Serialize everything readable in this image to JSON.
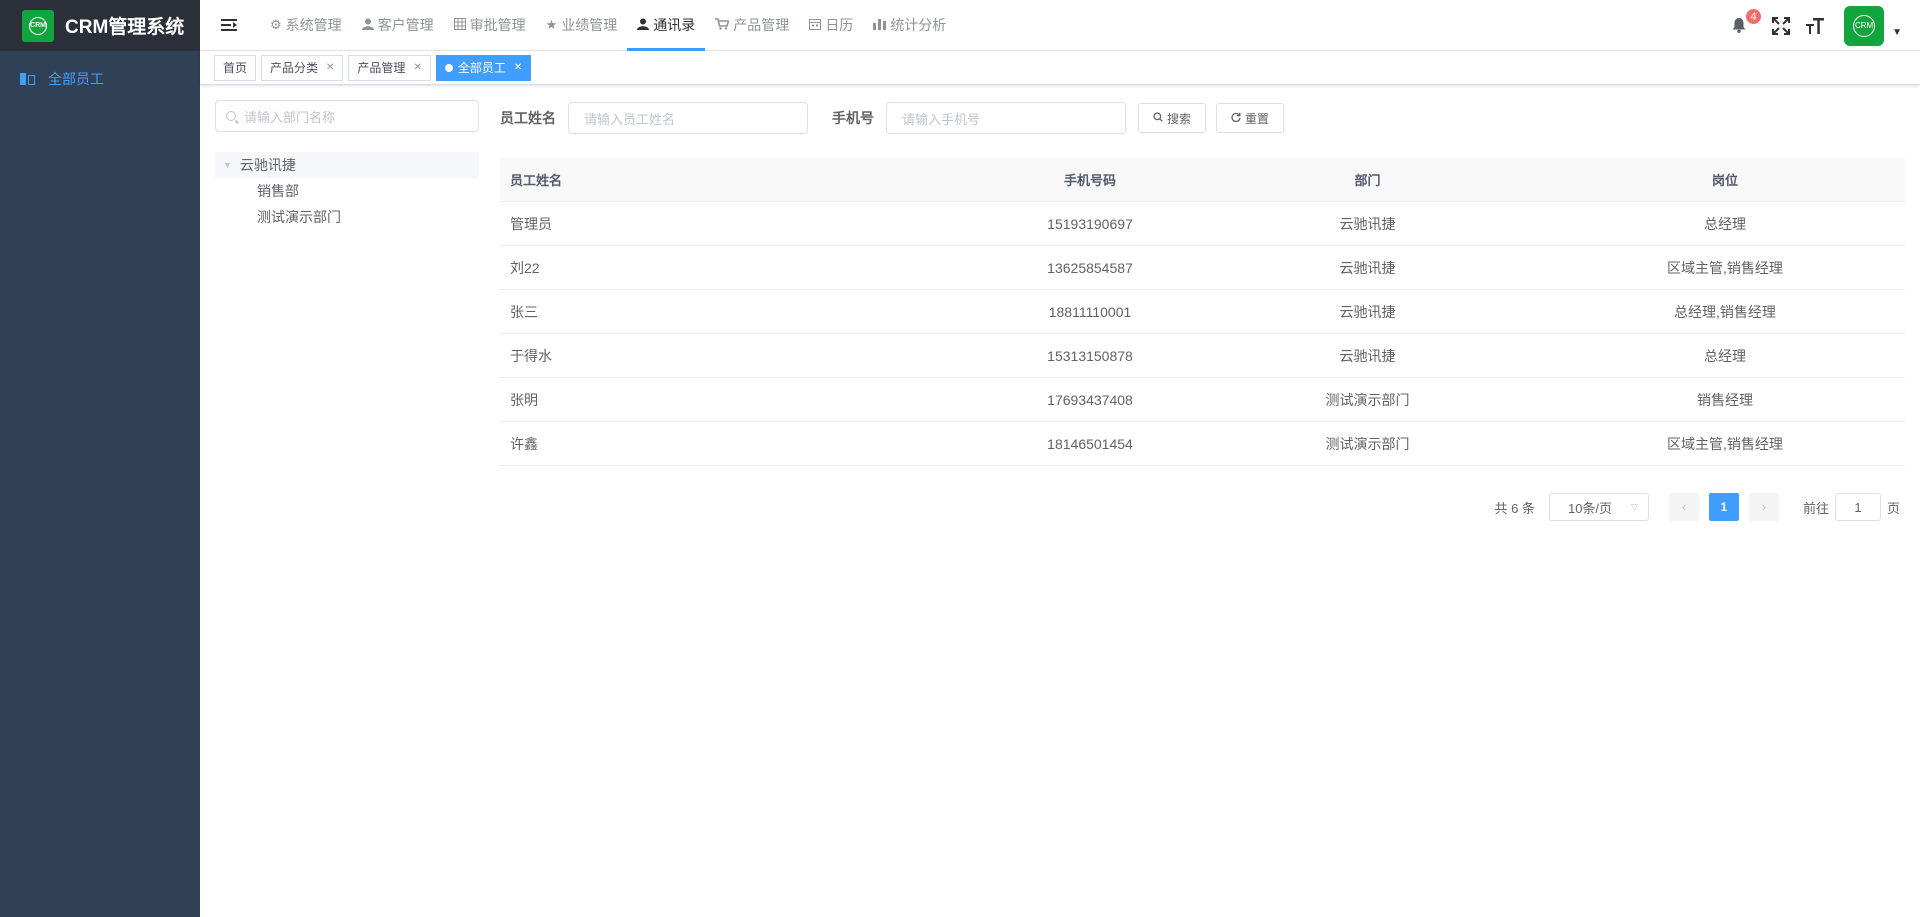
{
  "app": {
    "logo_text": "CRM",
    "title": "CRM管理系统"
  },
  "sidebar": {
    "items": [
      {
        "label": "全部员工"
      }
    ]
  },
  "navbar": {
    "tabs": [
      {
        "label": "系统管理",
        "icon": "gear-icon"
      },
      {
        "label": "客户管理",
        "icon": "user-icon"
      },
      {
        "label": "审批管理",
        "icon": "grid-icon"
      },
      {
        "label": "业绩管理",
        "icon": "star-icon"
      },
      {
        "label": "通讯录",
        "icon": "user-icon"
      },
      {
        "label": "产品管理",
        "icon": "cart-icon"
      },
      {
        "label": "日历",
        "icon": "calendar-icon"
      },
      {
        "label": "统计分析",
        "icon": "bar-chart-icon"
      }
    ],
    "active_tab": "通讯录",
    "notification_count": "4",
    "avatar_text": "CRM"
  },
  "tags": [
    {
      "label": "首页",
      "closable": false
    },
    {
      "label": "产品分类",
      "closable": true
    },
    {
      "label": "产品管理",
      "closable": true
    },
    {
      "label": "全部员工",
      "closable": true,
      "active": true
    }
  ],
  "dept": {
    "search_placeholder": "请输入部门名称",
    "root": "云驰讯捷",
    "children": [
      "销售部",
      "测试演示部门"
    ]
  },
  "form": {
    "name_label": "员工姓名",
    "name_placeholder": "请输入员工姓名",
    "phone_label": "手机号",
    "phone_placeholder": "请输入手机号",
    "search_btn": "搜索",
    "reset_btn": "重置"
  },
  "table": {
    "columns": [
      "员工姓名",
      "手机号码",
      "部门",
      "岗位"
    ],
    "rows": [
      [
        "管理员",
        "15193190697",
        "云驰讯捷",
        "总经理"
      ],
      [
        "刘22",
        "13625854587",
        "云驰讯捷",
        "区域主管,销售经理"
      ],
      [
        "张三",
        "18811110001",
        "云驰讯捷",
        "总经理,销售经理"
      ],
      [
        "于得水",
        "15313150878",
        "云驰讯捷",
        "总经理"
      ],
      [
        "张明",
        "17693437408",
        "测试演示部门",
        "销售经理"
      ],
      [
        "许鑫",
        "18146501454",
        "测试演示部门",
        "区域主管,销售经理"
      ]
    ]
  },
  "pagination": {
    "total": "共 6 条",
    "page_size": "10条/页",
    "current_page": "1",
    "goto_label": "前往",
    "goto_value": "1",
    "page_suffix": "页"
  },
  "colors": {
    "primary": "#409eff",
    "sidebar_bg": "#304156",
    "logo_bg": "#2b2f3a",
    "brand_green": "#13a53d",
    "badge_red": "#f56c6c"
  }
}
